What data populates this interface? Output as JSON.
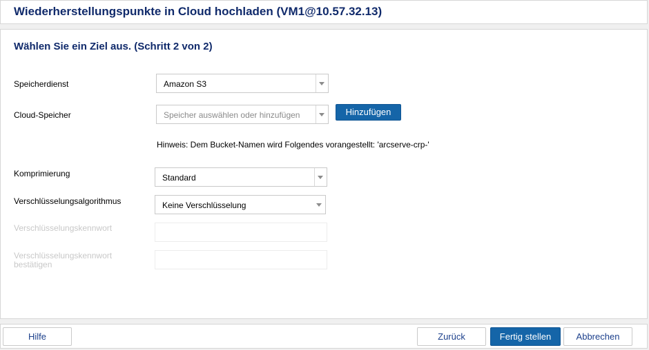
{
  "header": {
    "title": "Wiederherstellungspunkte in Cloud hochladen (VM1@10.57.32.13)"
  },
  "step": {
    "title": "Wählen Sie ein Ziel aus. (Schritt 2 von 2)"
  },
  "form": {
    "storage_service": {
      "label": "Speicherdienst",
      "value": "Amazon S3"
    },
    "cloud_storage": {
      "label": "Cloud-Speicher",
      "placeholder": "Speicher auswählen oder hinzufügen",
      "add_button": "Hinzufügen"
    },
    "hint": "Hinweis: Dem Bucket-Namen wird Folgendes vorangestellt: 'arcserve-crp-'",
    "compression": {
      "label": "Komprimierung",
      "value": "Standard"
    },
    "encryption_algorithm": {
      "label": "Verschlüsselungsalgorithmus",
      "value": "Keine Verschlüsselung"
    },
    "encryption_password": {
      "label": "Verschlüsselungskennwort"
    },
    "confirm_password": {
      "label_line1": "Verschlüsselungskennwort",
      "label_line2": "bestätigen"
    }
  },
  "footer": {
    "help": "Hilfe",
    "back": "Zurück",
    "finish": "Fertig stellen",
    "cancel": "Abbrechen"
  }
}
